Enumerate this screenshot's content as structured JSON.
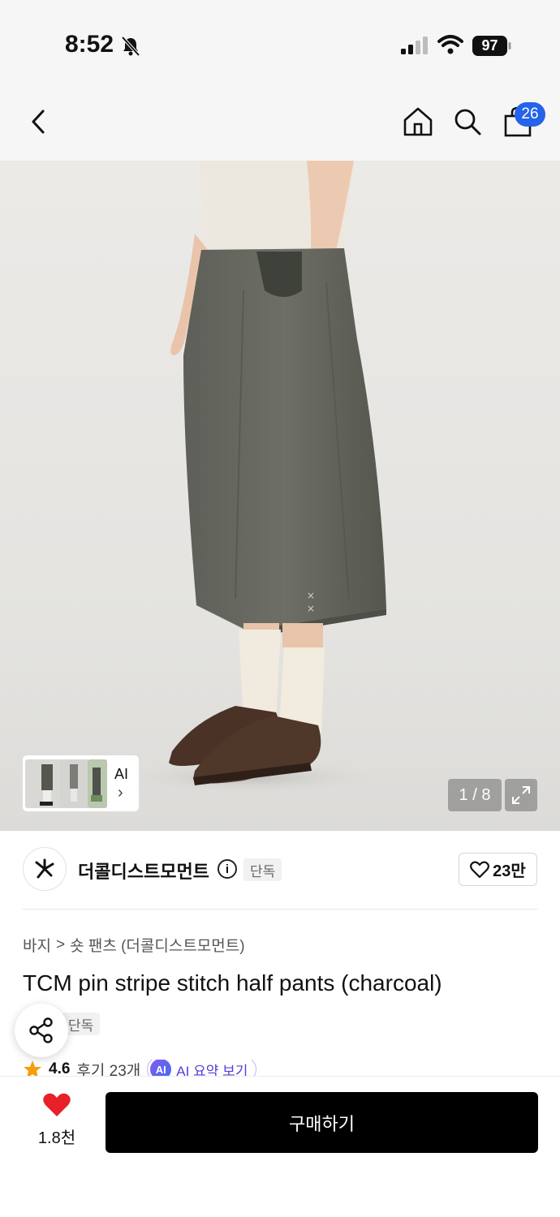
{
  "status_bar": {
    "time": "8:52",
    "battery": "97",
    "icons": [
      "bell-off-icon",
      "cellular-signal-icon",
      "wifi-icon",
      "battery-icon"
    ]
  },
  "nav": {
    "icons": [
      "back-chevron-icon",
      "home-icon",
      "search-icon",
      "shopping-bag-icon"
    ],
    "cart_count": "26"
  },
  "gallery": {
    "page": "1 / 8",
    "current_index": 1,
    "total": 8,
    "thumb_ai_label": "AI",
    "thumb_ai_chevron": "›"
  },
  "brand": {
    "name": "더콜디스트모먼트",
    "exclusive_tag": "단독",
    "likes": "23만"
  },
  "product": {
    "breadcrumb": [
      "바지",
      "숏 팬츠 (더콜디스트모먼트)"
    ],
    "breadcrumb_separator": ">",
    "title": "TCM pin stripe stitch half pants (charcoal)",
    "exclusive_tag": "단독",
    "rating": "4.6",
    "reviews": "후기 23개",
    "ai_summary_badge": "AI",
    "ai_summary_label": "AI 요약 보기"
  },
  "bottom": {
    "wish_count": "1.8천",
    "buy_label": "구매하기"
  },
  "colors": {
    "accent_blue": "#2563eb",
    "wish_red": "#e8202a",
    "buy_button": "#000000",
    "star_orange": "#f59e0b",
    "ai_purple": "#5b3bd6"
  }
}
